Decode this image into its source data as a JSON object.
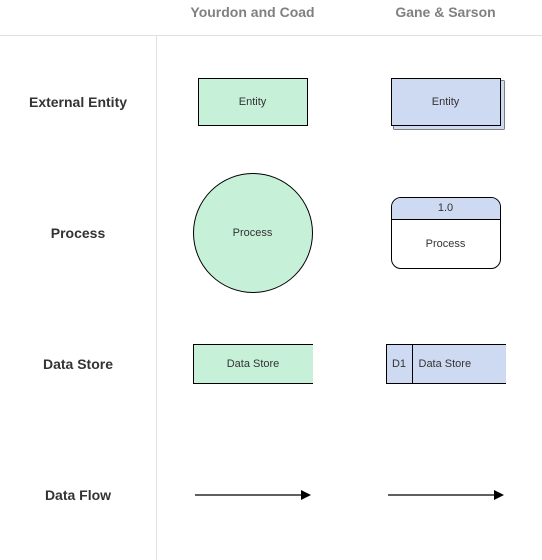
{
  "headers": {
    "col1": "Yourdon and Coad",
    "col2": "Gane & Sarson"
  },
  "rows": {
    "external_entity": {
      "label": "External Entity",
      "yc_label": "Entity",
      "gs_label": "Entity"
    },
    "process": {
      "label": "Process",
      "yc_label": "Process",
      "gs_id": "1.0",
      "gs_label": "Process"
    },
    "data_store": {
      "label": "Data Store",
      "yc_label": "Data Store",
      "gs_id": "D1",
      "gs_label": "Data Store"
    },
    "data_flow": {
      "label": "Data Flow"
    }
  },
  "colors": {
    "yc_fill": "#c7f0d9",
    "gs_fill": "#ced9f2"
  }
}
